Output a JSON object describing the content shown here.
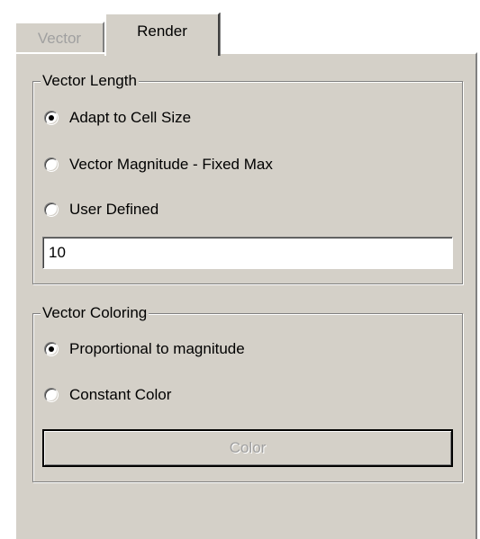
{
  "tabs": [
    {
      "label": "Vector",
      "active": false,
      "enabled": false
    },
    {
      "label": "Render",
      "active": true,
      "enabled": true
    }
  ],
  "vector_length": {
    "title": "Vector Length",
    "options": [
      {
        "label": "Adapt to Cell Size",
        "checked": true
      },
      {
        "label": "Vector Magnitude - Fixed Max",
        "checked": false
      },
      {
        "label": "User Defined",
        "checked": false
      }
    ],
    "user_value": "10"
  },
  "vector_coloring": {
    "title": "Vector Coloring",
    "options": [
      {
        "label": "Proportional to magnitude",
        "checked": true
      },
      {
        "label": "Constant Color",
        "checked": false
      }
    ],
    "color_button_label": "Color",
    "color_button_enabled": false
  },
  "colors": {
    "face": "#d4d0c8",
    "highlight": "#ffffff",
    "shadow": "#808080",
    "dark_shadow": "#404040",
    "disabled_text": "#a0a0a0"
  }
}
